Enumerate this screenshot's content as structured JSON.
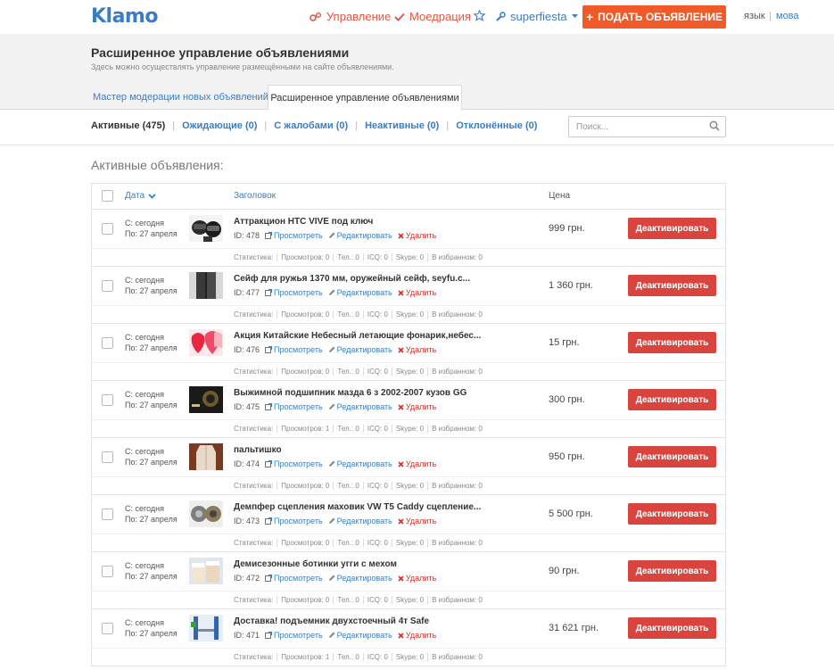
{
  "header": {
    "logo": "Klamo",
    "manage_label": "Управление",
    "moderation_label": "Моедрация",
    "username": "superfiesta",
    "post_button": "ПОДАТЬ ОБЪЯВЛЕНИЕ",
    "lang_1": "язык",
    "lang_sep": "|",
    "lang_2": "мова"
  },
  "page": {
    "title": "Расширенное управление объявлениями",
    "subtitle": "Здесь можно осуществлять управление размещёнными на сайте объявлениями.",
    "tabs": [
      {
        "label": "Мастер модерации новых объявлений"
      },
      {
        "label": "Расширенное управление объявлениями"
      }
    ]
  },
  "filters": [
    {
      "label": "Активные (475)"
    },
    {
      "label": "Ожидающие (0)"
    },
    {
      "label": "С жалобами (0)"
    },
    {
      "label": "Неактивные (0)"
    },
    {
      "label": "Отклонённые (0)"
    }
  ],
  "search": {
    "placeholder": "Поиск..."
  },
  "section_title": "Активные объявления:",
  "table": {
    "col_date": "Дата",
    "col_title": "Заголовок",
    "col_price": "Цена",
    "view_label": "Просмотреть",
    "edit_label": "Редактировать",
    "delete_label": "Удалить",
    "deactivate_label": "Деактивировать",
    "rows": [
      {
        "from": "С: сегодня",
        "to": "По: 27 апреля",
        "title": "Аттракцион HTC VIVE под ключ",
        "id": "ID: 478",
        "price": "999 грн.",
        "thumb": "vr",
        "stats": [
          "Статистика:",
          "Просмотров: 0",
          "Тел.: 0",
          "ICQ: 0",
          "Skype: 0",
          "В избранном: 0"
        ]
      },
      {
        "from": "С: сегодня",
        "to": "По: 27 апреля",
        "title": "Сейф для ружья 1370 мм, оружейный сейф, seyfu.c...",
        "id": "ID: 477",
        "price": "1 360 грн.",
        "thumb": "safe",
        "stats": [
          "Статистика:",
          "Просмотров: 0",
          "Тел.: 0",
          "ICQ: 0",
          "Skype: 0",
          "В избранном: 0"
        ]
      },
      {
        "from": "С: сегодня",
        "to": "По: 27 апреля",
        "title": "Акция Китайские Небесный летающие фонарик,небес...",
        "id": "ID: 476",
        "price": "15 грн.",
        "thumb": "lantern",
        "stats": [
          "Статистика:",
          "Просмотров: 0",
          "Тел.: 0",
          "ICQ: 0",
          "Skype: 0",
          "В избранном: 0"
        ]
      },
      {
        "from": "С: сегодня",
        "to": "По: 27 апреля",
        "title": "Выжимной подшипник мазда 6 з 2002-2007 кузов GG",
        "id": "ID: 475",
        "price": "300 грн.",
        "thumb": "bearing",
        "stats": [
          "Статистика:",
          "Просмотров: 1",
          "Тел.: 0",
          "ICQ: 0",
          "Skype: 0",
          "В избранном: 0"
        ]
      },
      {
        "from": "С: сегодня",
        "to": "По: 27 апреля",
        "title": "пальтишко",
        "id": "ID: 474",
        "price": "950 грн.",
        "thumb": "coat",
        "stats": [
          "Статистика:",
          "Просмотров: 0",
          "Тел.: 0",
          "ICQ: 0",
          "Skype: 0",
          "В избранном: 0"
        ]
      },
      {
        "from": "С: сегодня",
        "to": "По: 27 апреля",
        "title": "Демпфер сцепления маховик VW T5 Caddy сцепление...",
        "id": "ID: 473",
        "price": "5 500 грн.",
        "thumb": "clutch",
        "stats": [
          "Статистика:",
          "Просмотров: 0",
          "Тел.: 0",
          "ICQ: 0",
          "Skype: 0",
          "В избранном: 0"
        ]
      },
      {
        "from": "С: сегодня",
        "to": "По: 27 апреля",
        "title": "Демисезонные ботинки угги с мехом",
        "id": "ID: 472",
        "price": "90 грн.",
        "thumb": "boots",
        "stats": [
          "Статистика:",
          "Просмотров: 0",
          "Тел.: 0",
          "ICQ: 0",
          "Skype: 0",
          "В избранном: 0"
        ]
      },
      {
        "from": "С: сегодня",
        "to": "По: 27 апреля",
        "title": "Доставка! подъемник двухстоечный 4т Safe",
        "id": "ID: 471",
        "price": "31 621 грн.",
        "thumb": "lift",
        "stats": [
          "Статистика:",
          "Просмотров: 1",
          "Тел.: 0",
          "ICQ: 0",
          "Skype: 0",
          "В избранном: 0"
        ]
      }
    ]
  },
  "colors": {
    "brand": "#3b7dc4",
    "accent": "#f05a28",
    "danger": "#d9443f",
    "nav_red": "#e8553e"
  }
}
